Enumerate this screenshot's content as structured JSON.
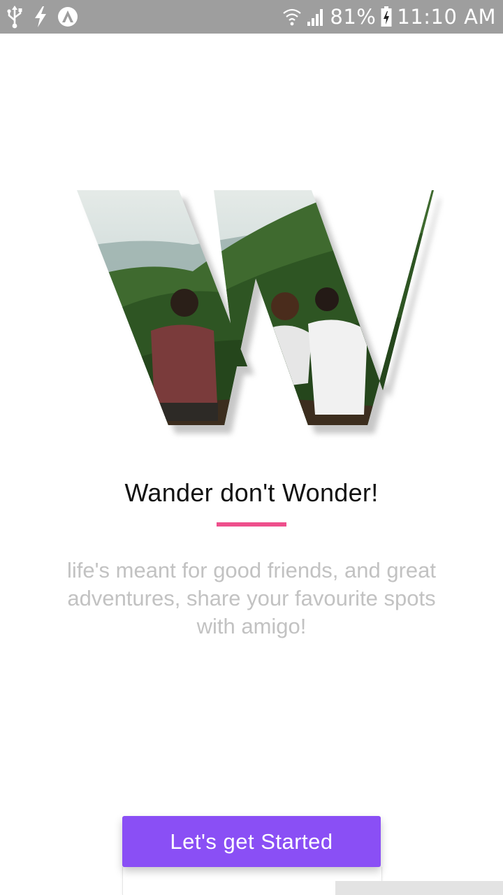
{
  "status_bar": {
    "left_icons": [
      "usb-icon",
      "flash-icon",
      "app-a-icon"
    ],
    "right_icons": [
      "wifi-icon",
      "signal-icon",
      "battery-charging-icon"
    ],
    "battery": "81%",
    "time": "11:10 AM"
  },
  "hero": {
    "icon": "w-letter-photo"
  },
  "title": "Wander don't Wonder!",
  "tagline": "life's meant for good friends, and great adventures, share your favourite spots with amigo!",
  "cta": {
    "label": "Let's get Started"
  },
  "colors": {
    "status_bar_bg": "#9e9e9e",
    "accent_pink": "#ee4f8c",
    "button_purple": "#8a4ff5",
    "tagline_gray": "#c2c2c2"
  }
}
